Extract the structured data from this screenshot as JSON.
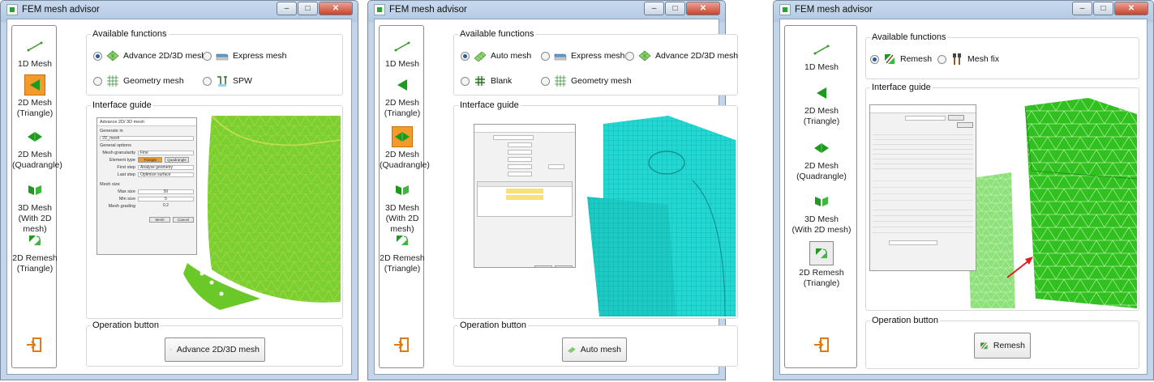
{
  "colors": {
    "accent_orange": "#f39a2a",
    "mesh_green": "#6cdc2c",
    "mesh_cyan": "#22d8d2",
    "arrow_red": "#e02020"
  },
  "windows": [
    {
      "title": "FEM mesh advisor",
      "window_controls": [
        "minimize",
        "maximize",
        "close"
      ],
      "sidebar": [
        {
          "label_l1": "1D Mesh",
          "label_l2": "",
          "icon": "1d-mesh-icon"
        },
        {
          "label_l1": "2D Mesh",
          "label_l2": "(Triangle)",
          "icon": "triangle-mesh-icon",
          "selected": true
        },
        {
          "label_l1": "2D Mesh",
          "label_l2": "(Quadrangle)",
          "icon": "quad-mesh-icon"
        },
        {
          "label_l1": "3D Mesh",
          "label_l2": "(With 2D mesh)",
          "icon": "3d-mesh-icon"
        },
        {
          "label_l1": "2D Remesh",
          "label_l2": "(Triangle)",
          "icon": "remesh-icon"
        }
      ],
      "available_functions_title": "Available functions",
      "functions": [
        {
          "label": "Advance 2D/3D mesh",
          "icon": "advance-mesh-icon",
          "selected": true
        },
        {
          "label": "Express mesh",
          "icon": "express-mesh-icon",
          "selected": false
        },
        {
          "label": "Geometry mesh",
          "icon": "geometry-mesh-icon",
          "selected": false
        },
        {
          "label": "SPW",
          "icon": "spw-icon",
          "selected": false
        }
      ],
      "interface_guide_title": "Interface guide",
      "guide_dialog": {
        "title": "Advance 2D/ 3D mesh",
        "generate_in": "Generate in",
        "generate_value": "2D_mesh",
        "general_options": "General options",
        "mesh_granularity_label": "Mesh granularity",
        "mesh_granularity_value": "Fine",
        "element_type_label": "Element type",
        "element_type_tri": "Triangle",
        "element_type_quad": "Quadrangle",
        "first_step_label": "First step",
        "first_step_value": "Analyse geometry",
        "last_step_label": "Last step",
        "last_step_value": "Optimize surface",
        "mesh_size": "Mesh size",
        "max_size_label": "Max size",
        "max_size_value": "50",
        "min_size_label": "Min size",
        "min_size_value": "5",
        "mesh_grading_label": "Mesh grading",
        "mesh_grading_value": "0.2",
        "mesh_btn": "Mesh",
        "cancel_btn": "Cancel"
      },
      "operation_title": "Operation button",
      "operation_label": "Advance 2D/3D mesh",
      "operation_icon": "advance-mesh-icon"
    },
    {
      "title": "FEM mesh advisor",
      "window_controls": [
        "minimize",
        "maximize",
        "close"
      ],
      "sidebar": [
        {
          "label_l1": "1D Mesh",
          "label_l2": "",
          "icon": "1d-mesh-icon"
        },
        {
          "label_l1": "2D Mesh",
          "label_l2": "(Triangle)",
          "icon": "triangle-mesh-icon"
        },
        {
          "label_l1": "2D Mesh",
          "label_l2": "(Quadrangle)",
          "icon": "quad-mesh-icon",
          "selected": true
        },
        {
          "label_l1": "3D Mesh",
          "label_l2": "(With 2D mesh)",
          "icon": "3d-mesh-icon"
        },
        {
          "label_l1": "2D Remesh",
          "label_l2": "(Triangle)",
          "icon": "remesh-icon"
        }
      ],
      "available_functions_title": "Available functions",
      "functions": [
        {
          "label": "Auto mesh",
          "icon": "auto-mesh-icon",
          "selected": true
        },
        {
          "label": "Express mesh",
          "icon": "express-mesh-icon",
          "selected": false
        },
        {
          "label": "Advance 2D/3D mesh",
          "icon": "advance-mesh-icon",
          "selected": false
        },
        {
          "label": "Blank",
          "icon": "blank-icon",
          "selected": false
        },
        {
          "label": "Geometry mesh",
          "icon": "geometry-mesh-icon",
          "selected": false
        }
      ],
      "interface_guide_title": "Interface guide",
      "operation_title": "Operation button",
      "operation_label": "Auto mesh",
      "operation_icon": "auto-mesh-icon"
    },
    {
      "title": "FEM mesh advisor",
      "window_controls": [
        "minimize",
        "maximize",
        "close"
      ],
      "sidebar": [
        {
          "label_l1": "1D Mesh",
          "label_l2": "",
          "icon": "1d-mesh-icon"
        },
        {
          "label_l1": "2D Mesh",
          "label_l2": "(Triangle)",
          "icon": "triangle-mesh-icon"
        },
        {
          "label_l1": "2D Mesh",
          "label_l2": "(Quadrangle)",
          "icon": "quad-mesh-icon"
        },
        {
          "label_l1": "3D Mesh",
          "label_l2": "(With 2D mesh)",
          "icon": "3d-mesh-icon"
        },
        {
          "label_l1": "2D Remesh",
          "label_l2": "(Triangle)",
          "icon": "remesh-icon",
          "selected": true
        }
      ],
      "available_functions_title": "Available functions",
      "functions": [
        {
          "label": "Remesh",
          "icon": "remesh-icon",
          "selected": true
        },
        {
          "label": "Mesh fix",
          "icon": "mesh-fix-icon",
          "selected": false
        }
      ],
      "interface_guide_title": "Interface guide",
      "operation_title": "Operation button",
      "operation_label": "Remesh",
      "operation_icon": "remesh-icon"
    }
  ]
}
